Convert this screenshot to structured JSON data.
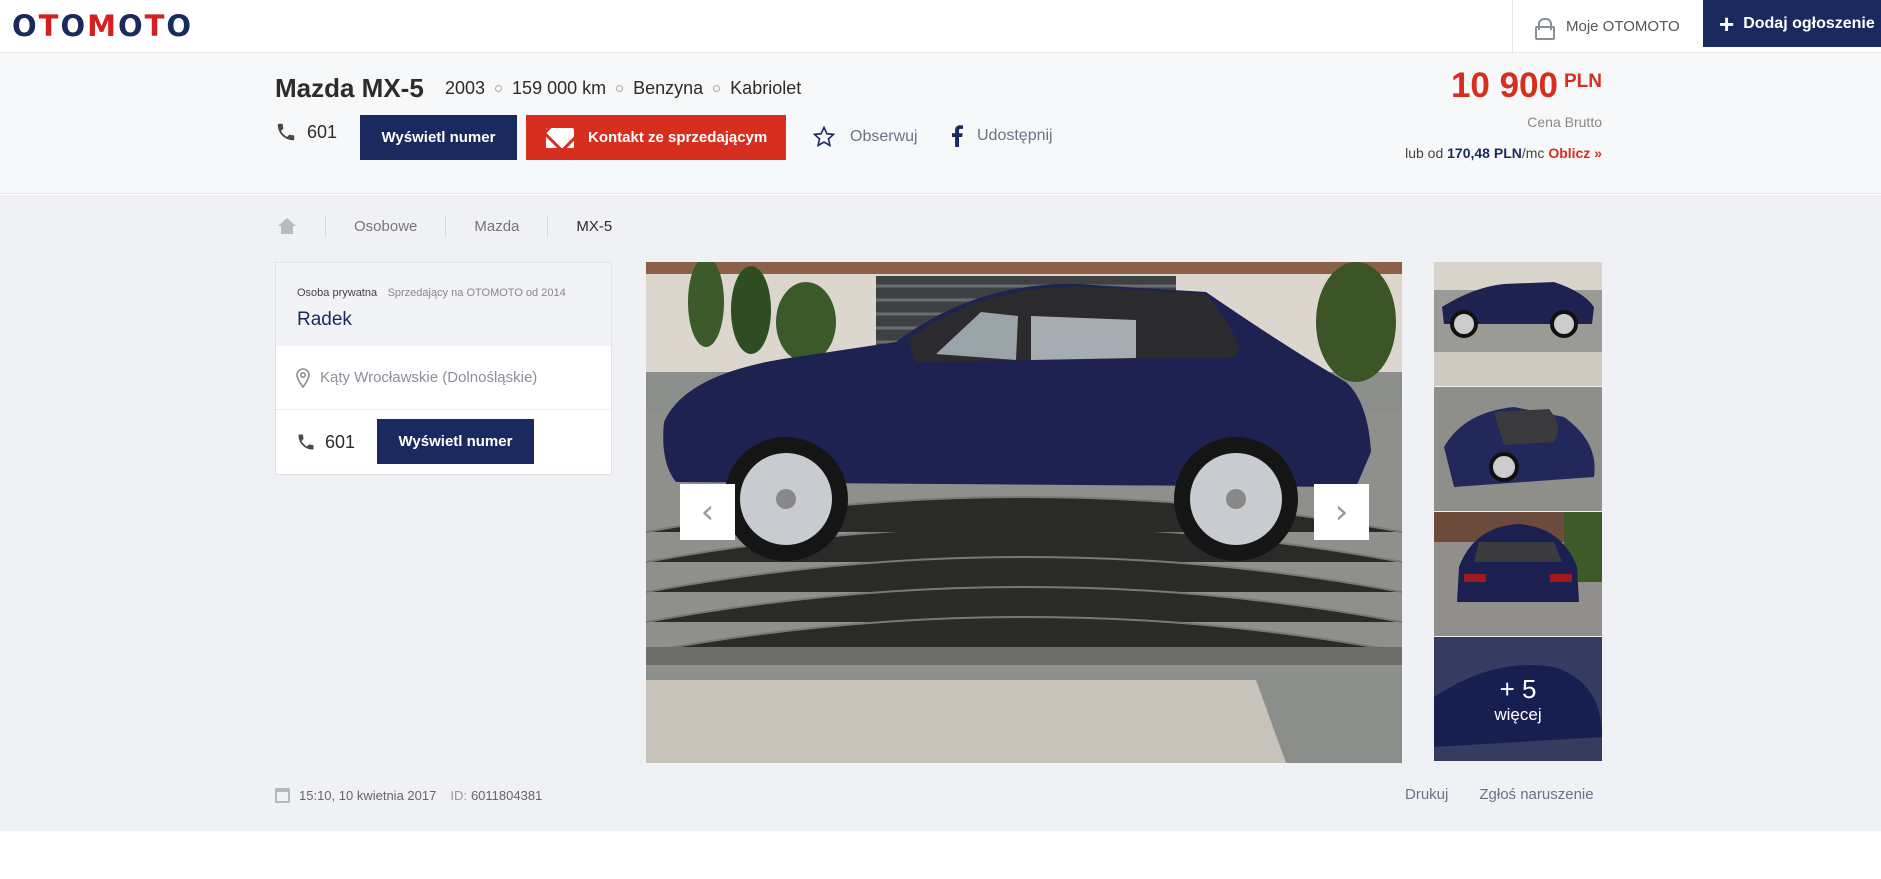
{
  "brand": {
    "logo_text": "OTOMOTO"
  },
  "nav": {
    "account_label": "Moje OTOMOTO",
    "add_ad_label": "Dodaj ogłoszenie"
  },
  "listing": {
    "title": "Mazda MX-5",
    "specs": [
      "2003",
      "159 000 km",
      "Benzyna",
      "Kabriolet"
    ],
    "phone_prefix": "601",
    "show_number_label": "Wyświetl numer",
    "contact_label": "Kontakt ze sprzedającym",
    "watch_label": "Obserwuj",
    "share_label": "Udostępnij",
    "price": "10 900",
    "currency": "PLN",
    "price_note": "Cena Brutto",
    "finance_prefix": "lub od",
    "finance_amount": "170,48 PLN",
    "finance_suffix": "/mc",
    "finance_link": "Oblicz »"
  },
  "breadcrumb": [
    "Osobowe",
    "Mazda",
    "MX-5"
  ],
  "seller": {
    "type": "Osoba prywatna",
    "since": "Sprzedający na OTOMOTO od 2014",
    "name": "Radek",
    "location": "Kąty Wrocławskie (Dolnośląskie)",
    "phone_prefix": "601",
    "show_number_label": "Wyświetl numer"
  },
  "gallery": {
    "more_count": "+ 5",
    "more_label": "więcej"
  },
  "meta": {
    "date": "15:10, 10 kwietnia 2017",
    "id_label": "ID:",
    "id_value": "6011804381",
    "print_label": "Drukuj",
    "report_label": "Zgłoś naruszenie"
  },
  "colors": {
    "navy": "#1b2a5e",
    "red": "#d62e1f"
  }
}
